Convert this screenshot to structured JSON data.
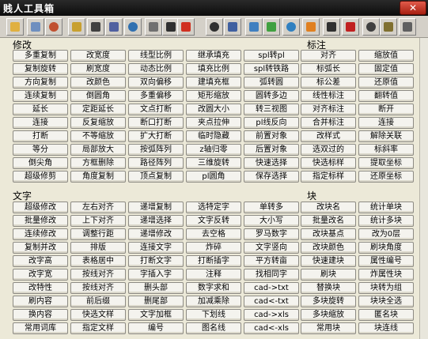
{
  "window": {
    "title": "贱人工具箱",
    "close_label": "✕"
  },
  "toolbar": {
    "icons": [
      {
        "name": "open-folder-icon",
        "color": "#e0b040"
      },
      {
        "name": "table-icon",
        "color": "#6f8fbf"
      },
      {
        "name": "home-icon",
        "color": "#c05030"
      },
      {
        "name": "lock-icon",
        "color": "#c8a030"
      },
      {
        "name": "print-icon",
        "color": "#404040"
      },
      {
        "name": "text-window-icon",
        "color": "#5060a0"
      },
      {
        "name": "zoom-icon",
        "color": "#3070b0"
      },
      {
        "name": "layer-icon",
        "color": "#707070"
      },
      {
        "name": "arrow-left-icon",
        "color": "#303030"
      },
      {
        "name": "color-bar-icon",
        "color": "#d03020"
      },
      {
        "name": "arrow-left-2-icon",
        "color": "#303030"
      },
      {
        "name": "move-icon",
        "color": "#4060a0"
      },
      {
        "name": "copy-icon",
        "color": "#4080c0"
      },
      {
        "name": "palette-icon",
        "color": "#40a040"
      },
      {
        "name": "grid-icon",
        "color": "#3080c0"
      },
      {
        "name": "orange-box-icon",
        "color": "#e08020"
      },
      {
        "name": "arrow-left-3-icon",
        "color": "#303030"
      },
      {
        "name": "magnet-icon",
        "color": "#c02020"
      },
      {
        "name": "cross-icon",
        "color": "#404040"
      },
      {
        "name": "gear-icon",
        "color": "#807030"
      },
      {
        "name": "disk-icon",
        "color": "#606060"
      }
    ]
  },
  "sections": {
    "modify": {
      "title": "修改",
      "rows": [
        [
          "多重复制",
          "改宽度",
          "线型比例",
          "继承填充",
          "spl转pl"
        ],
        [
          "复制旋转",
          "刷宽度",
          "动态比例",
          "填充比例",
          "spl转铁路"
        ],
        [
          "方向复制",
          "改颜色",
          "双向偏移",
          "建填充框",
          "弧转圆"
        ],
        [
          "连续复制",
          "倒圆角",
          "多重偏移",
          "矩形缩放",
          "圆转多边"
        ],
        [
          "延长",
          "定距延长",
          "文点打断",
          "改圆大小",
          "转三视图"
        ],
        [
          "连接",
          "反复缩放",
          "断口打断",
          "夹点拉伸",
          "pl线反向"
        ],
        [
          "打断",
          "不等缩放",
          "扩大打断",
          "临时隐藏",
          "前置对象"
        ],
        [
          "等分",
          "局部放大",
          "按弧阵列",
          "z轴归零",
          "后置对象"
        ],
        [
          "倒尖角",
          "方框删除",
          "路径阵列",
          "三维旋转",
          "快速选择"
        ],
        [
          "超级修剪",
          "角度复制",
          "顶点复制",
          "pl圆角",
          "保存选择"
        ]
      ]
    },
    "dimension": {
      "title": "标注",
      "rows": [
        [
          "对齐",
          "缩放值"
        ],
        [
          "标弧长",
          "固定值"
        ],
        [
          "标公差",
          "还原值"
        ],
        [
          "线性标注",
          "翻转值"
        ],
        [
          "对齐标注",
          "断开"
        ],
        [
          "合并标注",
          "连接"
        ],
        [
          "改样式",
          "解除关联"
        ],
        [
          "选双过的",
          "标斜率"
        ],
        [
          "快选标样",
          "提取坐标"
        ],
        [
          "指定标样",
          "还原坐标"
        ]
      ]
    },
    "text": {
      "title": "文字",
      "rows": [
        [
          "超级修改",
          "左右对齐",
          "递增复制",
          "选特定字",
          "单转多"
        ],
        [
          "批量修改",
          "上下对齐",
          "递增选择",
          "文字反转",
          "大小写"
        ],
        [
          "连续修改",
          "调整行距",
          "递增修改",
          "去空格",
          "罗马数字"
        ],
        [
          "复制并改",
          "排版",
          "连接文字",
          "炸碎",
          "文字竖向"
        ],
        [
          "改字高",
          "表格居中",
          "打断文字",
          "打断插字",
          "平方转亩"
        ],
        [
          "改字宽",
          "按线对齐",
          "字插入字",
          "注释",
          "找相同字"
        ],
        [
          "改特性",
          "按线对齐",
          "删头部",
          "数字求和",
          "cad->txt"
        ],
        [
          "刷内容",
          "前后缀",
          "删尾部",
          "加减乘除",
          "cad<-txt"
        ],
        [
          "换内容",
          "快选文样",
          "文字加框",
          "下划线",
          "cad->xls"
        ],
        [
          "常用词库",
          "指定文样",
          "编号",
          "图名线",
          "cad<-xls"
        ]
      ]
    },
    "block": {
      "title": "块",
      "rows": [
        [
          "改块名",
          "统计单块"
        ],
        [
          "批量改名",
          "统计多块"
        ],
        [
          "改块基点",
          "改为0层"
        ],
        [
          "改块颜色",
          "刷块角度"
        ],
        [
          "快速建块",
          "属性编号"
        ],
        [
          "刷块",
          "炸属性块"
        ],
        [
          "替换块",
          "块转为组"
        ],
        [
          "多块旋转",
          "块块全选"
        ],
        [
          "多块缩放",
          "匿名块"
        ],
        [
          "常用块",
          "块连线"
        ]
      ]
    }
  }
}
